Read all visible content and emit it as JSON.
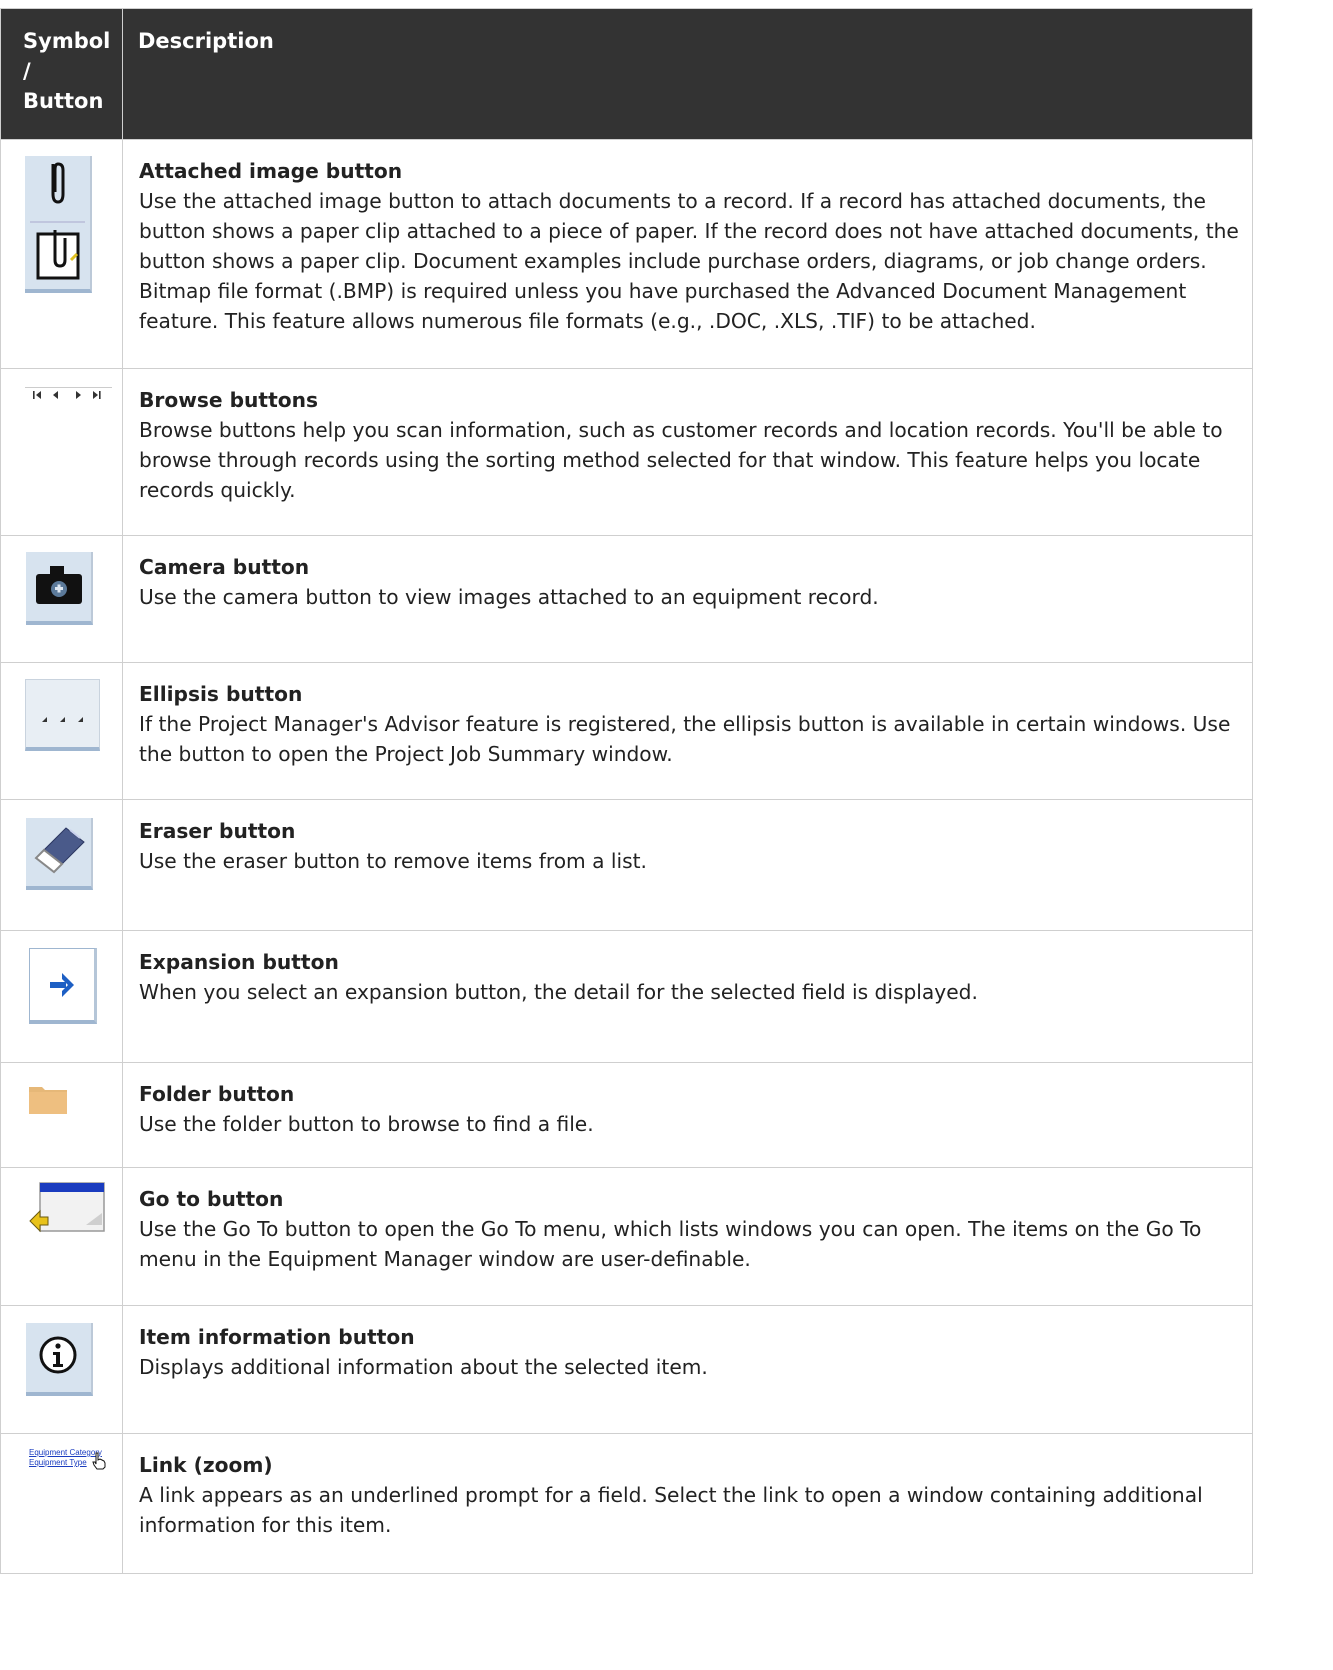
{
  "table": {
    "header": {
      "col1": "Symbol / Button",
      "col2": "Description"
    },
    "rows": [
      {
        "icon": "paperclip-attach-icon",
        "title": "Attached image button",
        "description": "Use the attached image button to attach documents to a record. If a record has attached documents, the button shows a paper clip attached to a piece of paper. If the record does not have attached documents, the button shows a paper clip. Document examples include purchase orders, diagrams, or job change orders. Bitmap file format (.BMP) is required unless you have purchased the Advanced Document Management feature. This feature allows numerous file formats (e.g., .DOC, .XLS, .TIF) to be attached."
      },
      {
        "icon": "browse-arrows-icon",
        "title": "Browse buttons",
        "description": "Browse buttons help you scan information, such as customer records and location records. You'll be able to browse through records using the sorting method selected for that window. This feature helps you locate records quickly."
      },
      {
        "icon": "camera-icon",
        "title": "Camera button",
        "description": "Use the camera button to view images attached to an equipment record."
      },
      {
        "icon": "ellipsis-icon",
        "title": "Ellipsis button",
        "description": "If the Project Manager's Advisor feature is registered, the ellipsis button is available in certain windows. Use the button to open the Project Job Summary window."
      },
      {
        "icon": "eraser-icon",
        "title": "Eraser button",
        "description": "Use the eraser button to remove items from a list."
      },
      {
        "icon": "arrow-right-icon",
        "title": "Expansion button",
        "description": "When you select an expansion button, the detail for the selected field is displayed."
      },
      {
        "icon": "folder-icon",
        "title": "Folder button",
        "description": "Use the folder button to browse to find a file."
      },
      {
        "icon": "go-to-window-icon",
        "title": "Go to button",
        "description": "Use the Go To button to open the Go To menu, which lists windows you can open. The items on the Go To menu in the Equipment Manager window are user-definable."
      },
      {
        "icon": "info-icon",
        "title": "Item information button",
        "description": "Displays additional information about the selected item."
      },
      {
        "icon": "link-zoom-icon",
        "title": "Link (zoom)",
        "description": "A link appears as an underlined prompt for a field. Select the link to open a window containing additional information for this item.",
        "icon_text": {
          "line1": "Equipment Category",
          "line2": "Equipment Type"
        }
      }
    ]
  }
}
